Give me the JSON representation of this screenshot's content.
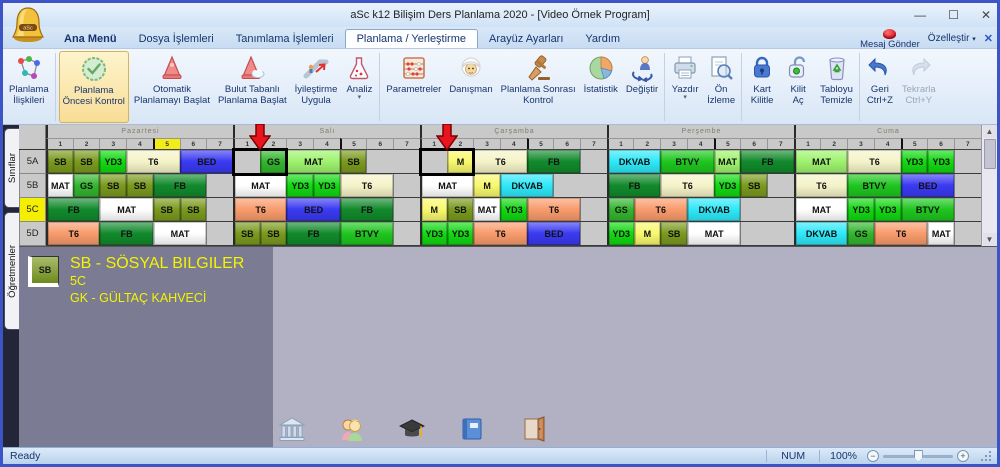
{
  "window": {
    "title": "aSc k12 Bilişim Ders Planlama 2020  -  [Video Örnek Program]",
    "minimize": "—",
    "maximize": "☐",
    "close": "✕"
  },
  "menu": {
    "tabs": [
      {
        "label": "Ana Menü",
        "bold": true
      },
      {
        "label": "Dosya İşlemleri"
      },
      {
        "label": "Tanımlama İşlemleri"
      },
      {
        "label": "Planlama / Yerleştirme",
        "active": true
      },
      {
        "label": "Arayüz Ayarları"
      },
      {
        "label": "Yardım"
      }
    ],
    "mesaj_gonder": "Mesaj Gönder",
    "ozellestir": "Özelleştir",
    "ozellestir_caret": "▾",
    "close_doc": "✕"
  },
  "ribbon": {
    "buttons": [
      {
        "label": "Planlama\nİlişkileri",
        "icon": "molecule",
        "group_end": true
      },
      {
        "label": "Planlama\nÖncesi Kontrol",
        "icon": "check-seal",
        "active": true
      },
      {
        "label": "Otomatik\nPlanlamayı Başlat",
        "icon": "cone"
      },
      {
        "label": "Bulut Tabanlı\nPlanlama Başlat",
        "icon": "cone-cloud"
      },
      {
        "label": "İyileştirme\nUygula",
        "icon": "escalator"
      },
      {
        "label": "Analiz",
        "icon": "flask",
        "dropdown": true,
        "group_end": true
      },
      {
        "label": "Parametreler",
        "icon": "abacus"
      },
      {
        "label": "Danışman",
        "icon": "advisor"
      },
      {
        "label": "Planlama Sonrası\nKontrol",
        "icon": "gavel"
      },
      {
        "label": "İstatistik",
        "icon": "pie"
      },
      {
        "label": "Değiştir",
        "icon": "swap",
        "group_end": true
      },
      {
        "label": "Yazdır",
        "icon": "printer",
        "dropdown": true
      },
      {
        "label": "Ön\nİzleme",
        "icon": "preview",
        "group_end": true
      },
      {
        "label": "Kart\nKilitle",
        "icon": "lock"
      },
      {
        "label": "Kilit\nAç",
        "icon": "unlock"
      },
      {
        "label": "Tabloyu\nTemizle",
        "icon": "trash",
        "group_end": true
      },
      {
        "label": "Geri\nCtrl+Z",
        "icon": "undo"
      },
      {
        "label": "Tekrarla\nCtrl+Y",
        "icon": "redo",
        "disabled": true
      }
    ]
  },
  "timetable": {
    "side_tabs": [
      "Sınıflar",
      "Öğretmenler"
    ],
    "periods": [
      "1",
      "2",
      "3",
      "4",
      "5",
      "6",
      "7"
    ],
    "days": [
      {
        "name": "Pazartesi",
        "highlight_period": 5
      },
      {
        "name": "Salı"
      },
      {
        "name": "Çarşamba"
      },
      {
        "name": "Perşembe"
      },
      {
        "name": "Cuma"
      }
    ],
    "palette": {
      "olive": "#7a9a1e",
      "green": "#33b52e",
      "bgreen": "#12d812",
      "green2": "#1ec61e",
      "lgreen": "#9ef26e",
      "dgreen": "#128a2c",
      "cream": "#f4f3c8",
      "salmon": "#f89b6c",
      "blue": "#3a3af2",
      "cyan": "#2ee8f8",
      "yellow": "#f8f86e",
      "white": "#ffffff",
      "empty": "#c9c9c9",
      "selection_border": "#000000",
      "arrow": "#e8141e",
      "arrow_outline": "#7a0000",
      "selected_row_label": "#f4ee00",
      "highlight_header": "#f2ec17"
    },
    "rows": [
      {
        "label": "5A",
        "days": [
          [
            {
              "t": "SB",
              "s": 1,
              "c": "olive"
            },
            {
              "t": "SB",
              "s": 1,
              "c": "olive"
            },
            {
              "t": "YD3",
              "s": 1,
              "c": "bgreen"
            },
            {
              "t": "T6",
              "s": 2,
              "c": "cream"
            },
            {
              "t": "BED",
              "s": 2,
              "c": "blue"
            }
          ],
          [
            {
              "t": "",
              "s": 1,
              "c": "empty"
            },
            {
              "t": "GS",
              "s": 1,
              "c": "green"
            },
            {
              "t": "MAT",
              "s": 2,
              "c": "lgreen"
            },
            {
              "t": "SB",
              "s": 1,
              "c": "olive"
            },
            {
              "t": "",
              "s": 2,
              "c": "empty"
            }
          ],
          [
            {
              "t": "",
              "s": 1,
              "c": "empty"
            },
            {
              "t": "M",
              "s": 1,
              "c": "yellow"
            },
            {
              "t": "T6",
              "s": 2,
              "c": "cream"
            },
            {
              "t": "FB",
              "s": 2,
              "c": "dgreen"
            },
            {
              "t": "",
              "s": 1,
              "c": "empty"
            }
          ],
          [
            {
              "t": "DKVAB",
              "s": 2,
              "c": "cyan"
            },
            {
              "t": "BTVY",
              "s": 2,
              "c": "green2"
            },
            {
              "t": "MAT",
              "s": 1,
              "c": "lgreen"
            },
            {
              "t": "FB",
              "s": 2,
              "c": "dgreen"
            }
          ],
          [
            {
              "t": "MAT",
              "s": 2,
              "c": "lgreen"
            },
            {
              "t": "T6",
              "s": 2,
              "c": "cream"
            },
            {
              "t": "YD3",
              "s": 1,
              "c": "bgreen"
            },
            {
              "t": "YD3",
              "s": 1,
              "c": "bgreen"
            },
            {
              "t": "",
              "s": 1,
              "c": "empty"
            }
          ]
        ]
      },
      {
        "label": "5B",
        "days": [
          [
            {
              "t": "MAT",
              "s": 1,
              "c": "white"
            },
            {
              "t": "GS",
              "s": 1,
              "c": "green"
            },
            {
              "t": "SB",
              "s": 1,
              "c": "olive"
            },
            {
              "t": "SB",
              "s": 1,
              "c": "olive"
            },
            {
              "t": "FB",
              "s": 2,
              "c": "dgreen"
            },
            {
              "t": "",
              "s": 1,
              "c": "empty"
            }
          ],
          [
            {
              "t": "MAT",
              "s": 2,
              "c": "white"
            },
            {
              "t": "YD3",
              "s": 1,
              "c": "bgreen"
            },
            {
              "t": "YD3",
              "s": 1,
              "c": "bgreen"
            },
            {
              "t": "T6",
              "s": 2,
              "c": "cream"
            },
            {
              "t": "",
              "s": 1,
              "c": "empty"
            }
          ],
          [
            {
              "t": "MAT",
              "s": 2,
              "c": "white"
            },
            {
              "t": "M",
              "s": 1,
              "c": "yellow"
            },
            {
              "t": "DKVAB",
              "s": 2,
              "c": "cyan"
            },
            {
              "t": "",
              "s": 2,
              "c": "empty"
            }
          ],
          [
            {
              "t": "FB",
              "s": 2,
              "c": "dgreen"
            },
            {
              "t": "T6",
              "s": 2,
              "c": "cream"
            },
            {
              "t": "YD3",
              "s": 1,
              "c": "bgreen"
            },
            {
              "t": "SB",
              "s": 1,
              "c": "olive"
            },
            {
              "t": "",
              "s": 1,
              "c": "empty"
            }
          ],
          [
            {
              "t": "T6",
              "s": 2,
              "c": "cream"
            },
            {
              "t": "BTVY",
              "s": 2,
              "c": "green2"
            },
            {
              "t": "BED",
              "s": 2,
              "c": "blue"
            },
            {
              "t": "",
              "s": 1,
              "c": "empty"
            }
          ]
        ]
      },
      {
        "label": "5C",
        "selected": true,
        "days": [
          [
            {
              "t": "FB",
              "s": 2,
              "c": "dgreen"
            },
            {
              "t": "MAT",
              "s": 2,
              "c": "white"
            },
            {
              "t": "SB",
              "s": 1,
              "c": "olive"
            },
            {
              "t": "SB",
              "s": 1,
              "c": "olive"
            },
            {
              "t": "",
              "s": 1,
              "c": "empty"
            }
          ],
          [
            {
              "t": "T6",
              "s": 2,
              "c": "salmon"
            },
            {
              "t": "BED",
              "s": 2,
              "c": "blue"
            },
            {
              "t": "FB",
              "s": 2,
              "c": "dgreen"
            },
            {
              "t": "",
              "s": 1,
              "c": "empty"
            }
          ],
          [
            {
              "t": "M",
              "s": 1,
              "c": "yellow"
            },
            {
              "t": "SB",
              "s": 1,
              "c": "olive"
            },
            {
              "t": "MAT",
              "s": 1,
              "c": "white"
            },
            {
              "t": "YD3",
              "s": 1,
              "c": "bgreen"
            },
            {
              "t": "T6",
              "s": 2,
              "c": "salmon"
            },
            {
              "t": "",
              "s": 1,
              "c": "empty"
            }
          ],
          [
            {
              "t": "GS",
              "s": 1,
              "c": "green"
            },
            {
              "t": "T6",
              "s": 2,
              "c": "salmon"
            },
            {
              "t": "DKVAB",
              "s": 2,
              "c": "cyan"
            },
            {
              "t": "",
              "s": 2,
              "c": "empty"
            }
          ],
          [
            {
              "t": "MAT",
              "s": 2,
              "c": "white"
            },
            {
              "t": "YD3",
              "s": 1,
              "c": "bgreen"
            },
            {
              "t": "YD3",
              "s": 1,
              "c": "bgreen"
            },
            {
              "t": "BTVY",
              "s": 2,
              "c": "green2"
            },
            {
              "t": "",
              "s": 1,
              "c": "empty"
            }
          ]
        ]
      },
      {
        "label": "5D",
        "days": [
          [
            {
              "t": "T6",
              "s": 2,
              "c": "salmon"
            },
            {
              "t": "FB",
              "s": 2,
              "c": "dgreen"
            },
            {
              "t": "MAT",
              "s": 2,
              "c": "white"
            },
            {
              "t": "",
              "s": 1,
              "c": "empty"
            }
          ],
          [
            {
              "t": "SB",
              "s": 1,
              "c": "olive"
            },
            {
              "t": "SB",
              "s": 1,
              "c": "olive"
            },
            {
              "t": "FB",
              "s": 2,
              "c": "dgreen"
            },
            {
              "t": "BTVY",
              "s": 2,
              "c": "green2"
            },
            {
              "t": "",
              "s": 1,
              "c": "empty"
            }
          ],
          [
            {
              "t": "YD3",
              "s": 1,
              "c": "bgreen"
            },
            {
              "t": "YD3",
              "s": 1,
              "c": "bgreen"
            },
            {
              "t": "T6",
              "s": 2,
              "c": "salmon"
            },
            {
              "t": "BED",
              "s": 2,
              "c": "blue"
            },
            {
              "t": "",
              "s": 1,
              "c": "empty"
            }
          ],
          [
            {
              "t": "YD3",
              "s": 1,
              "c": "bgreen"
            },
            {
              "t": "M",
              "s": 1,
              "c": "yellow"
            },
            {
              "t": "SB",
              "s": 1,
              "c": "olive"
            },
            {
              "t": "MAT",
              "s": 2,
              "c": "white"
            },
            {
              "t": "",
              "s": 2,
              "c": "empty"
            }
          ],
          [
            {
              "t": "DKVAB",
              "s": 2,
              "c": "cyan"
            },
            {
              "t": "GS",
              "s": 1,
              "c": "green"
            },
            {
              "t": "T6",
              "s": 2,
              "c": "salmon"
            },
            {
              "t": "MAT",
              "s": 1,
              "c": "white"
            },
            {
              "t": "",
              "s": 1,
              "c": "empty"
            }
          ]
        ]
      }
    ],
    "selection_boxes": [
      {
        "row": 0,
        "day": 1,
        "col": 1,
        "span": 2
      },
      {
        "row": 0,
        "day": 2,
        "col": 1,
        "span": 2
      }
    ],
    "arrows": [
      {
        "day": 1,
        "boundary": 1
      },
      {
        "day": 2,
        "boundary": 1
      }
    ],
    "scroll_up": "▲",
    "scroll_down": "▼"
  },
  "legend": {
    "code": "SB",
    "line1": "SB - SÖSYAL BILGILER",
    "line2": "5C",
    "line3": "GK - GÜLTAÇ KAHVECİ"
  },
  "statusbar": {
    "ready": "Ready",
    "num": "NUM",
    "zoom": "100%",
    "minus": "−",
    "plus": "+"
  }
}
